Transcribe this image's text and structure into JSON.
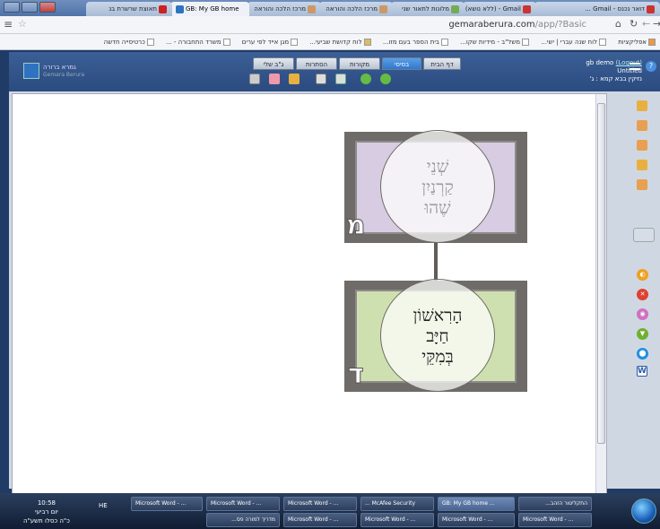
{
  "browser": {
    "tabs": [
      {
        "label": "דואר נכנס - Gmail ...",
        "fav": "#c33"
      },
      {
        "label": "Gmail - (ללא נושא)",
        "fav": "#c33"
      },
      {
        "label": "מלונות לתאור שני",
        "fav": "#7a5"
      },
      {
        "label": "מרכז הלכה והוראה",
        "fav": "#c96"
      },
      {
        "label": "מרכז הלכה והוראה",
        "fav": "#c96"
      },
      {
        "label": "GB: My GB home",
        "fav": "#2e73c0",
        "active": true
      },
      {
        "label": "תאוצת שרשרת בנ",
        "fav": "#c22"
      }
    ],
    "address": {
      "host": "gemaraberura.com",
      "path": "/app/?Basic"
    },
    "bookmarks": [
      "אפליקציות",
      "לוח שנה עברי | ישי...",
      "משל\"ב - מידיות שקו...",
      "בית הספר בעם מזו...",
      "לוח קדושת שביעי...",
      "מגן אייד לפי ערים",
      "משרד התחבורה - ...",
      "כרטיסייה חדשה"
    ]
  },
  "app": {
    "logo": {
      "name_he": "גמרא ברורה",
      "name_en": "Gemara Berura"
    },
    "tabs": [
      {
        "label": "דף הבית",
        "selected": false
      },
      {
        "label": "בסיסי",
        "selected": true
      },
      {
        "label": "מקורות",
        "selected": false
      },
      {
        "label": "הסתרות",
        "selected": false
      },
      {
        "label": "ג\"ב שלי",
        "selected": false
      }
    ],
    "user": {
      "name": "gb demo",
      "logout": "(Logout)",
      "doc": "Untitled",
      "ref": "נזיקין בבא קמא : ג'"
    },
    "cards": [
      {
        "letter": "מ",
        "line1": "שְׁנֵי",
        "line2": "קַרְנַיִן",
        "line3": "שֶׁהוּ",
        "color": "#d7cce2",
        "text_color": "#9a9a9a"
      },
      {
        "letter": "ד",
        "line1": "הָרִאשׁוֹן",
        "line2": "חַיָּב",
        "line3": "בְּמִקֵּי",
        "color": "#cfe0b0",
        "text_color": "#222222"
      }
    ]
  },
  "taskbar": {
    "time": "10:58",
    "day": "יום רביעי",
    "date": "כ\"ה כסלו תשע\"ה",
    "lang": "HE",
    "items_top": [
      "Microsoft Word - ...",
      "Microsoft Word - ...",
      "Microsoft Word - ...",
      "... McAfee Security",
      "GB: My GB home ...",
      "התקליטור הזהב..."
    ],
    "items_bottom": [
      "מדריך למורה פס...",
      "Microsoft Word - ...",
      "Microsoft Word - ...",
      "Microsoft Word - ...",
      "Microsoft Word - ..."
    ]
  }
}
